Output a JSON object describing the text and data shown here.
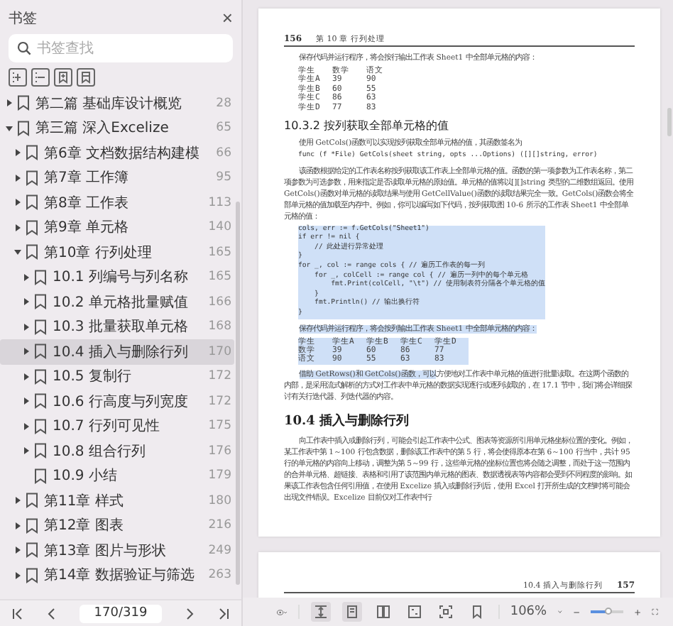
{
  "sidebar": {
    "title": "书签",
    "close": "×",
    "search": {
      "placeholder": "书签查找"
    },
    "tools": [
      {
        "kind": "expand"
      },
      {
        "kind": "collapse"
      },
      {
        "kind": "add"
      },
      {
        "kind": "bookmark"
      }
    ],
    "items": [
      {
        "label": "第二篇  基础库设计概览",
        "page": "28",
        "expanded": false,
        "selected": false
      },
      {
        "label": "第三篇  深入Excelize",
        "page": "65",
        "expanded": true,
        "selected": false,
        "children": [
          {
            "label": "第6章  文档数据结构建模",
            "page": "66",
            "expanded": false,
            "selected": false
          },
          {
            "label": "第7章  工作簿",
            "page": "95",
            "expanded": false,
            "selected": false
          },
          {
            "label": "第8章  工作表",
            "page": "113",
            "expanded": false,
            "selected": false
          },
          {
            "label": "第9章  单元格",
            "page": "140",
            "expanded": false,
            "selected": false
          },
          {
            "label": "第10章  行列处理",
            "page": "165",
            "expanded": true,
            "selected": false,
            "children": [
              {
                "label": "10.1  列编号与列名称",
                "page": "165",
                "expanded": false,
                "selected": false
              },
              {
                "label": "10.2  单元格批量赋值",
                "page": "166",
                "expanded": false,
                "selected": false
              },
              {
                "label": "10.3  批量获取单元格",
                "page": "168",
                "expanded": false,
                "selected": false
              },
              {
                "label": "10.4  插入与删除行列",
                "page": "170",
                "expanded": false,
                "selected": true
              },
              {
                "label": "10.5  复制行",
                "page": "172",
                "expanded": false,
                "selected": false
              },
              {
                "label": "10.6  行高度与列宽度",
                "page": "172",
                "expanded": false,
                "selected": false
              },
              {
                "label": "10.7  行列可见性",
                "page": "175",
                "expanded": false,
                "selected": false
              },
              {
                "label": "10.8  组合行列",
                "page": "176",
                "expanded": false,
                "selected": false
              },
              {
                "label": "10.9  小结",
                "page": "179",
                "selected": false
              }
            ]
          },
          {
            "label": "第11章  样式",
            "page": "180",
            "expanded": false,
            "selected": false
          },
          {
            "label": "第12章  图表",
            "page": "216",
            "expanded": false,
            "selected": false
          },
          {
            "label": "第13章  图片与形状",
            "page": "249",
            "expanded": false,
            "selected": false
          },
          {
            "label": "第14章  数据验证与筛选",
            "page": "263",
            "expanded": false,
            "selected": false
          }
        ]
      }
    ],
    "page_field": "170/319"
  },
  "pages": [
    {
      "page_number": "156",
      "running_head": "第 10 章  行列处理",
      "blocks": [
        {
          "kind": "para",
          "text": "保存代码并运行程序，将会按行输出工作表 Sheet1 中全部单元格的内容："
        },
        {
          "kind": "table",
          "selected": false,
          "rows": [
            [
              "学生",
              "数学",
              "语文"
            ],
            [
              "学生A",
              "39",
              "90"
            ],
            [
              "学生B",
              "60",
              "55"
            ],
            [
              "学生C",
              "86",
              "63"
            ],
            [
              "学生D",
              "77",
              "83"
            ]
          ]
        },
        {
          "kind": "heading",
          "text": "10.3.2  按列获取全部单元格的值"
        },
        {
          "kind": "para",
          "text": "使用 GetCols()函数可以实现按列获取全部单元格的值，其函数签名为"
        },
        {
          "kind": "code",
          "selected": false,
          "lines": [
            "func (f *File) GetCols(sheet string, opts ...Options) ([][]string, error)"
          ]
        },
        {
          "kind": "para",
          "text": "该函数根据给定的工作表名称按列获取该工作表上全部单元格的值。函数的第一项参数为工作表名称，第二项参数为可选参数，用来指定是否读取单元格的原始值。单元格的值将以[][]string 类型的二维数组返回。使用 GetCols()函数对单元格的读取结果与使用 GetCellValue()函数的读取结果完全一致。GetCols()函数会将全部单元格的值加载至内存中。例如，你可以编写如下代码，按列获取图 10-6 所示的工作表 Sheet1 中全部单元格的值："
        },
        {
          "kind": "code",
          "selected": true,
          "lines": [
            "cols, err := f.GetCols(\"Sheet1\")",
            "if err != nil {",
            "    // 此处进行异常处理",
            "}",
            "for _, col := range cols { // 遍历工作表的每一列",
            "    for _, colCell := range col { // 遍历一列中的每个单元格",
            "        fmt.Print(colCell, \"\\t\") // 使用制表符分隔各个单元格的值",
            "    }",
            "    fmt.Println() // 输出换行符",
            "}"
          ]
        },
        {
          "kind": "para",
          "selected": true,
          "text": "保存代码并运行程序，将会按列输出工作表 Sheet1 中全部单元格的内容："
        },
        {
          "kind": "table",
          "selected": true,
          "rows": [
            [
              "学生",
              "学生A",
              "学生B",
              "学生C",
              "学生D"
            ],
            [
              "数学",
              "39",
              "60",
              "86",
              "77"
            ],
            [
              "语文",
              "90",
              "55",
              "63",
              "83"
            ]
          ]
        },
        {
          "kind": "para",
          "selected_part": "借助 GetRows()和 GetCols()函数，可以",
          "text": "方便地对工作表中单元格的值进行批量读取。在这两个函数的内部，是采用流式解析的方式对工作表中单元格的数据实现逐行或逐列读取的，在 17.1 节中，我们将会详细探讨有关行迭代器、列迭代器的内容。"
        },
        {
          "kind": "section",
          "text": "10.4  插入与删除行列"
        },
        {
          "kind": "para",
          "text": "向工作表中插入或删除行列，可能会引起工作表中公式、图表等资源所引用单元格坐标位置的变化。例如，某工作表中第 1～100 行包含数据，删除该工作表中的第 5 行，将会使得原本在第 6～100 行当中，共计 95 行的单元格的内容向上移动，调整为第 5～99 行，这些单元格的坐标位置也将会随之调整，而处于这一范围内的合并单元格、超链接、表格和引用了该范围内单元格的图表、数据透视表等内容都会受到不同程度的影响。如果该工作表包含任何引用值，在使用 Excelize 插入或删除行列后，使用 Excel 打开所生成的文档时将可能会出现文件错误。Excelize 目前仅对工作表中行"
        }
      ]
    },
    {
      "page_number": "157",
      "running_head": "10.4  插入与删除行列"
    }
  ],
  "toolbar": {
    "view_buttons": [
      {
        "kind": "fit-height",
        "selected": true
      },
      {
        "kind": "single-page",
        "selected": true
      },
      {
        "kind": "two-page",
        "selected": false
      },
      {
        "kind": "fit-page",
        "selected": false
      },
      {
        "kind": "actual-size",
        "selected": false
      },
      {
        "kind": "bookmark",
        "selected": false
      }
    ],
    "zoom": "106%",
    "zoom_slider": {
      "level": 0.55
    }
  }
}
